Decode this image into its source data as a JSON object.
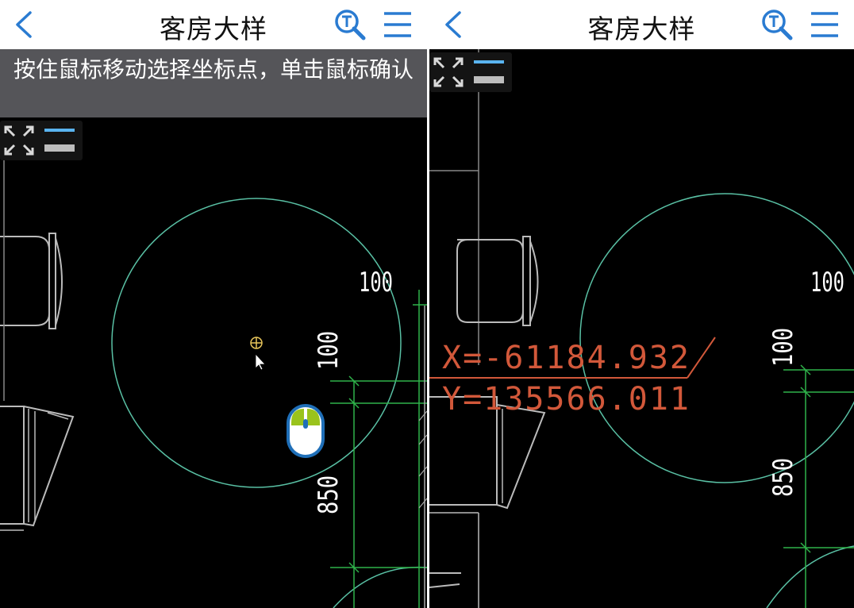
{
  "left_pane": {
    "header": {
      "title": "客房大样"
    },
    "banner": {
      "instruction": "按住鼠标移动选择坐标点，单击鼠标确认"
    },
    "dimensions": [
      "100",
      "100",
      "850"
    ],
    "icons": [
      "back-icon",
      "text-search-icon",
      "menu-icon",
      "expand-icon",
      "layers-icon",
      "crosshair-icon",
      "cursor-arrow-icon",
      "mouse-icon"
    ]
  },
  "right_pane": {
    "header": {
      "title": "客房大样"
    },
    "dimensions": [
      "100",
      "100",
      "850"
    ],
    "coordinates": {
      "x": "X=-61184.932",
      "y": "Y=135566.011"
    },
    "icons": [
      "back-icon",
      "text-search-icon",
      "menu-icon",
      "expand-icon",
      "layers-icon"
    ]
  },
  "colors": {
    "header_bg": "#ffffff",
    "accent_blue": "#2a7bd1",
    "banner_bg": "#555559",
    "canvas_bg": "#000000",
    "cad_green": "#2fb24a",
    "circle_teal": "#59c0a4",
    "coord_orange": "#d2583a",
    "mouse_green": "#9ac31c"
  }
}
